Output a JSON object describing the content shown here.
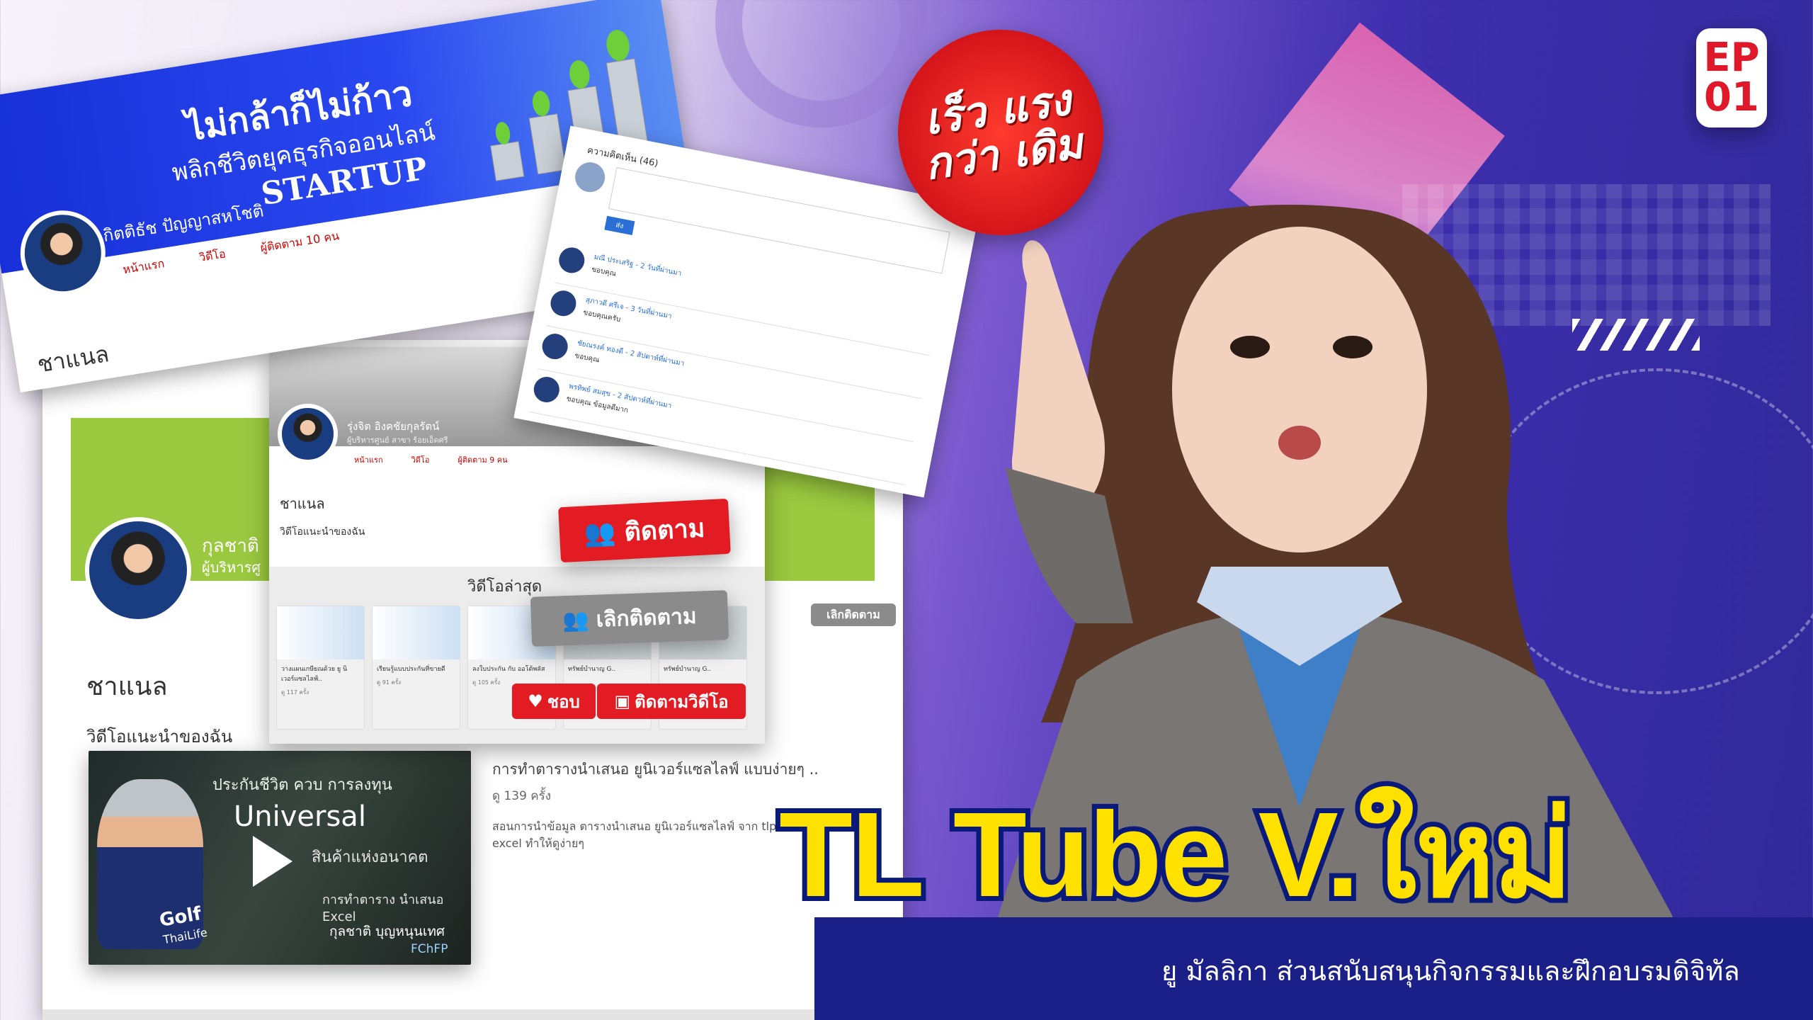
{
  "badge": {
    "line1": "เร็ว แรง",
    "line2": "กว่า เดิม"
  },
  "episode": {
    "ep": "EP",
    "num": "01"
  },
  "title": "TL Tube V.ใหม่",
  "subtitle": "ยู มัลลิกา ส่วนสนับสนุนกิจกรรมและฝึกอบรมดิจิทัล",
  "card1": {
    "headline": "ไม่กล้าก็ไม่ก้าว",
    "subhead": "พลิกชีวิตยุคธุรกิจออนไลน์",
    "startup": "STARTUP",
    "name": "กิตติธัช ปัญญาสหโชติ",
    "nav": [
      "หน้าแรก",
      "วิดีโอ",
      "ผู้ติดตาม 10 คน"
    ],
    "channel": "ชาแนล"
  },
  "card2": {
    "name_partial": "กุลชาติ",
    "role_partial": "ผู้บริหารศู",
    "channel": "ชาแนล",
    "recommended": "วิดีโอแนะนำของฉัน",
    "unfollow_small": "เลิกติดตาม",
    "video_title": "การทำตารางนำเสนอ ยูนิเวอร์แซลไลฟ์ แบบง่ายๆ ..",
    "views": "ดู 139 ครั้ง",
    "desc": "สอนการนำข้อมูล ตารางนำเสนอ ยูนิเวอร์แซลไลฟ์ จาก tlpro excel ทำให้ดูง่ายๆ",
    "thumb": {
      "line1": "ประกันชีวิต ควบ การลงทุน",
      "brand": "Universal",
      "line2": "สินค้าแห่งอนาคต",
      "line3": "การทำตาราง นำเสนอ Excel",
      "presenter": "กุลชาติ บุญหนุนเทศ",
      "cert": "FChFP",
      "logo1": "Golf",
      "logo2": "ThaiLife"
    }
  },
  "card3": {
    "name": "รุ่งจิต อิงคชัยกุลรัตน์",
    "role": "ผู้บริหารศูนย์ สาขา ร้อยเอ็ดศรี",
    "nav": [
      "หน้าแรก",
      "วิดีโอ",
      "ผู้ติดตาม 9 คน"
    ],
    "channel": "ชาแนล",
    "recommended": "วิดีโอแนะนำของฉัน",
    "latest": "วิดีโอล่าสุด",
    "follow": "ติดตาม",
    "unfollow": "เลิกติดตาม",
    "like": "ชอบ",
    "follow_video": "ติดตามวิดีโอ",
    "thumbs": [
      {
        "t": "วางแผนเกษียณด้วย ยู นิเวอร์แซลไลฟ์..",
        "v": "ดู 117 ครั้ง"
      },
      {
        "t": "เรียนรู้แบบประกันที่ขายดี",
        "v": "ดู 91 ครั้ง"
      },
      {
        "t": "ลงใบประกัน กับ ออโต้พลัส",
        "v": "ดู 105 ครั้ง"
      },
      {
        "t": "ทรัพย์บำนาญ G..",
        "v": ""
      },
      {
        "t": "ทรัพย์บำนาญ G..",
        "v": ""
      }
    ]
  },
  "card4": {
    "header": "ความคิดเห็น (46)",
    "send": "ส่ง",
    "comments": [
      {
        "n": "มณี ประเสริฐ - 2 วันที่ผ่านมา",
        "c": "ขอบคุณ"
      },
      {
        "n": "สุภาวดี ศรีเจ - 3 วันที่ผ่านมา",
        "c": "ขอบคุณครับ"
      },
      {
        "n": "ชัยณรงค์ ทองดี - 2 สัปดาห์ที่ผ่านมา",
        "c": "ขอบคุณ"
      },
      {
        "n": "พรทิพย์ สมสุข - 2 สัปดาห์ที่ผ่านมา",
        "c": "ขอบคุณ ข้อมูลดีมาก"
      }
    ]
  }
}
